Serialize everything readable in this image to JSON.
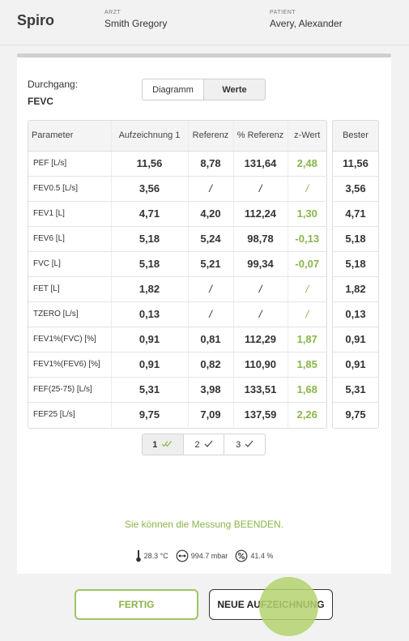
{
  "header": {
    "app_title": "Spiro",
    "doctor_label": "ARZT",
    "doctor_name": "Smith Gregory",
    "patient_label": "PATIENT",
    "patient_name": "Avery, Alexander"
  },
  "run": {
    "label": "Durchgang:",
    "value": "FEVC"
  },
  "view_toggle": {
    "options": [
      "Diagramm",
      "Werte"
    ],
    "active": "Werte"
  },
  "table": {
    "headers": [
      "Parameter",
      "Aufzeichnung 1",
      "Referenz",
      "% Referenz",
      "z-Wert"
    ],
    "best_header": "Bester",
    "rows": [
      {
        "param": "PEF [L/s]",
        "rec": "11,56",
        "ref": "8,78",
        "pct": "131,64",
        "z": "2,48",
        "best": "11,56"
      },
      {
        "param": "FEV0.5 [L/s]",
        "rec": "3,56",
        "ref": "/",
        "pct": "/",
        "z": "/",
        "best": "3,56"
      },
      {
        "param": "FEV1 [L]",
        "rec": "4,71",
        "ref": "4,20",
        "pct": "112,24",
        "z": "1,30",
        "best": "4,71"
      },
      {
        "param": "FEV6 [L]",
        "rec": "5,18",
        "ref": "5,24",
        "pct": "98,78",
        "z": "-0,13",
        "best": "5,18"
      },
      {
        "param": "FVC [L]",
        "rec": "5,18",
        "ref": "5,21",
        "pct": "99,34",
        "z": "-0,07",
        "best": "5,18"
      },
      {
        "param": "FET [L]",
        "rec": "1,82",
        "ref": "/",
        "pct": "/",
        "z": "/",
        "best": "1,82"
      },
      {
        "param": "TZERO [L/s]",
        "rec": "0,13",
        "ref": "/",
        "pct": "/",
        "z": "/",
        "best": "0,13"
      },
      {
        "param": "FEV1%(FVC) [%]",
        "rec": "0,91",
        "ref": "0,81",
        "pct": "112,29",
        "z": "1,87",
        "best": "0,91"
      },
      {
        "param": "FEV1%(FEV6) [%]",
        "rec": "0,91",
        "ref": "0,82",
        "pct": "110,90",
        "z": "1,85",
        "best": "0,91"
      },
      {
        "param": "FEF(25-75) [L/s]",
        "rec": "5,31",
        "ref": "3,98",
        "pct": "133,51",
        "z": "1,68",
        "best": "5,31"
      },
      {
        "param": "FEF25 [L/s]",
        "rec": "9,75",
        "ref": "7,09",
        "pct": "137,59",
        "z": "2,26",
        "best": "9,75"
      }
    ]
  },
  "pager": {
    "pages": [
      {
        "label": "1",
        "active": true,
        "check": "double-check-icon"
      },
      {
        "label": "2",
        "active": false,
        "check": "check-icon"
      },
      {
        "label": "3",
        "active": false,
        "check": "check-icon"
      }
    ]
  },
  "message": "Sie können die Messung BEENDEN.",
  "environment": {
    "temperature": "28.3 °C",
    "pressure": "994.7 mbar",
    "humidity": "41.4 %"
  },
  "buttons": {
    "done": "FERTIG",
    "new_recording": "NEUE AUFZEICHNUNG"
  },
  "colors": {
    "accent_green": "#8ab54a",
    "border_green": "#9cc664"
  }
}
